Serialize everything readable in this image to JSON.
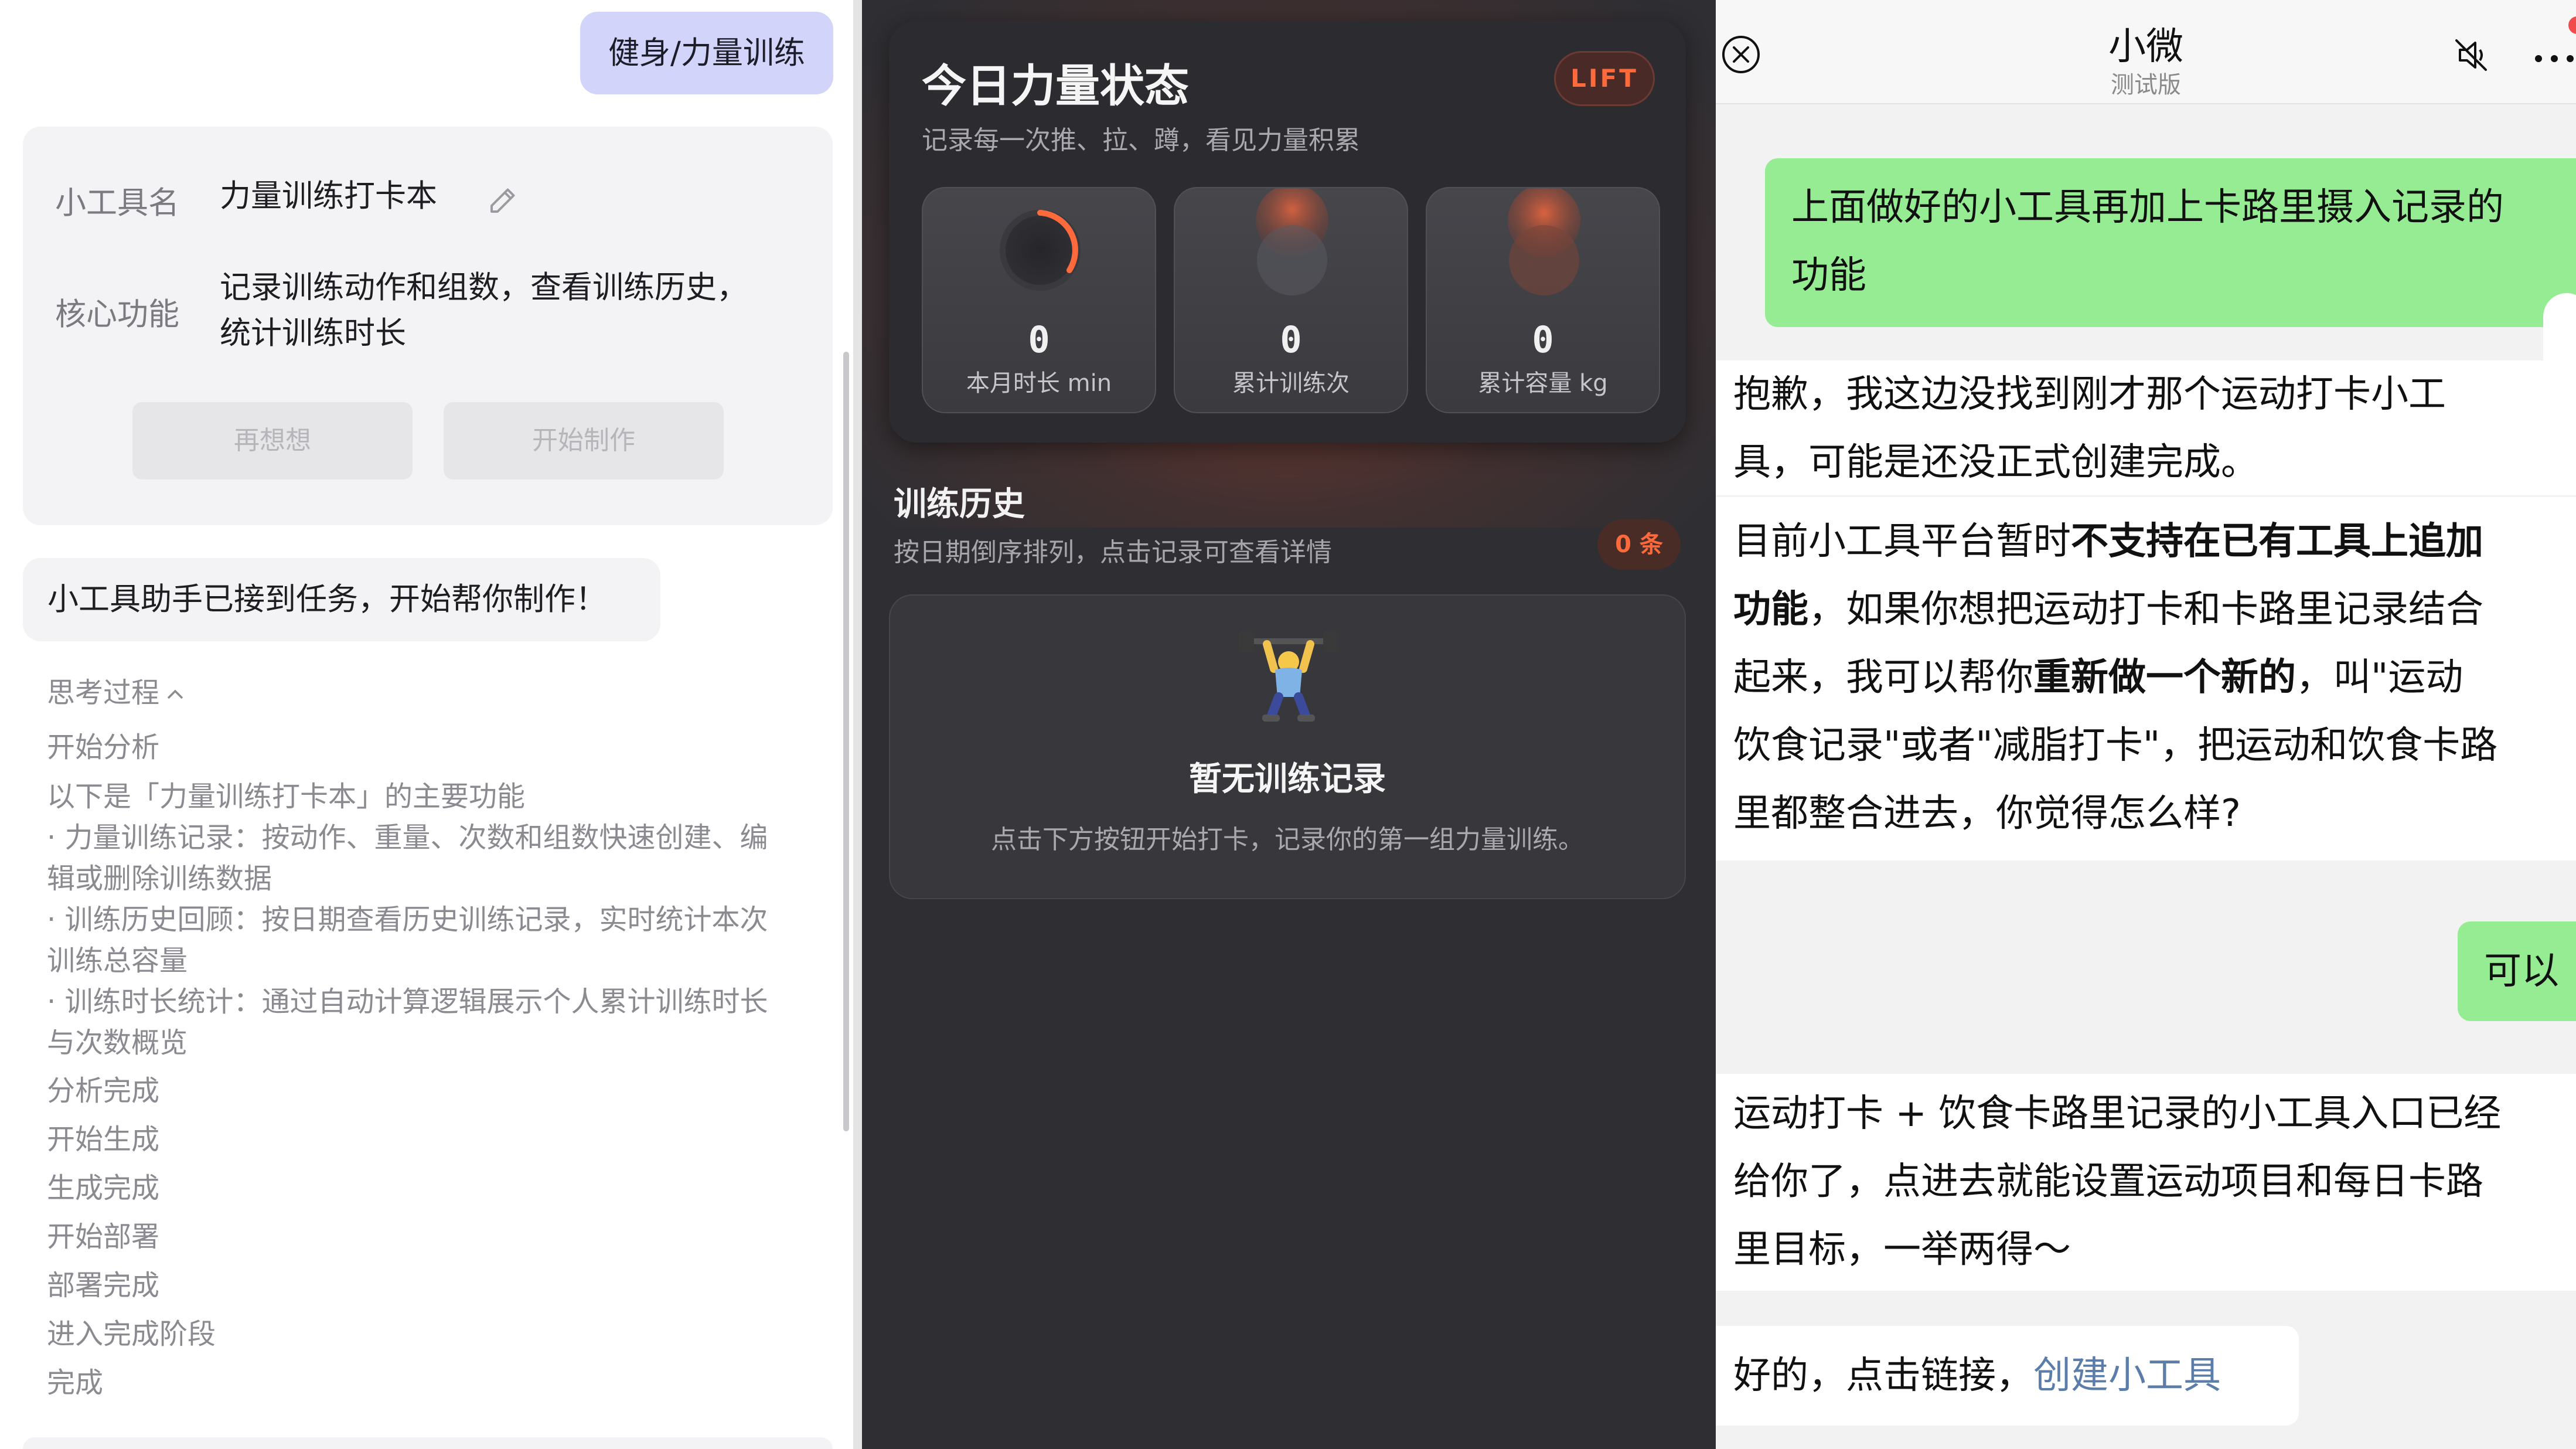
{
  "left": {
    "user_message": "健身/力量训练",
    "tool_card": {
      "name_label": "小工具名",
      "name_value": "力量训练打卡本",
      "function_label": "核心功能",
      "function_line1": "记录训练动作和组数，查看训练历史，",
      "function_line2": "统计训练时长",
      "rethink_button": "再想想",
      "start_button": "开始制作"
    },
    "assistant_message": "小工具助手已接到任务，开始帮你制作！",
    "thinking": {
      "header": "思考过程",
      "steps": [
        "开始分析",
        "以下是「力量训练打卡本」的主要功能",
        "· 力量训练记录：按动作、重量、次数和组数快速创建、编",
        "辑或删除训练数据",
        "· 训练历史回顾：按日期查看历史训练记录，实时统计本次",
        "训练总容量",
        "· 训练时长统计：通过自动计算逻辑展示个人累计训练时长",
        "与次数概览",
        "分析完成",
        "开始生成",
        "生成完成",
        "开始部署",
        "部署完成",
        "进入完成阶段",
        "完成"
      ]
    }
  },
  "middle": {
    "title": "今日力量状态",
    "badge": "LIFT",
    "subtitle": "记录每一次推、拉、蹲，看见力量积累",
    "stats": [
      {
        "value": "0",
        "label": "本月时长 min"
      },
      {
        "value": "0",
        "label": "累计训练次"
      },
      {
        "value": "0",
        "label": "累计容量 kg"
      }
    ],
    "history_title": "训练历史",
    "history_subtitle": "按日期倒序排列，点击记录可查看详情",
    "history_count": "0 条",
    "empty_title": "暂无训练记录",
    "empty_subtitle": "点击下方按钮开始打卡，记录你的第一组力量训练。",
    "accent_color": "#ff6a3d"
  },
  "right": {
    "title": "小微",
    "subtitle": "测试版",
    "user_message_1_line1": "上面做好的小工具再加上卡路里摄入记录的",
    "user_message_1_line2": "功能",
    "reply_1": {
      "line1": "抱歉，我这边没找到刚才那个运动打卡小工",
      "line2": "具，可能是还没正式创建完成。"
    },
    "reply_2": {
      "l1_a": "目前小工具平台暂时",
      "l1_b": "不支持在已有工具上追加",
      "l2_a": "功能",
      "l2_b": "，如果你想把运动打卡和卡路里记录结合",
      "l3": "起来，我可以帮你",
      "l3_b": "重新做一个新的",
      "l3_c": "，叫\"运动",
      "l4": "饮食记录\"或者\"减脂打卡\"，把运动和饮食卡路",
      "l5": "里都整合进去，你觉得怎么样?"
    },
    "user_message_2": "可以",
    "reply_3": {
      "line1": "运动打卡 + 饮食卡路里记录的小工具入口已经",
      "line2": "给你了，点进去就能设置运动项目和每日卡路",
      "line3": "里目标，一举两得～"
    },
    "reply_4_text": "好的，点击链接，",
    "reply_4_link": "创建小工具",
    "bubble_color": "#95ec92"
  }
}
